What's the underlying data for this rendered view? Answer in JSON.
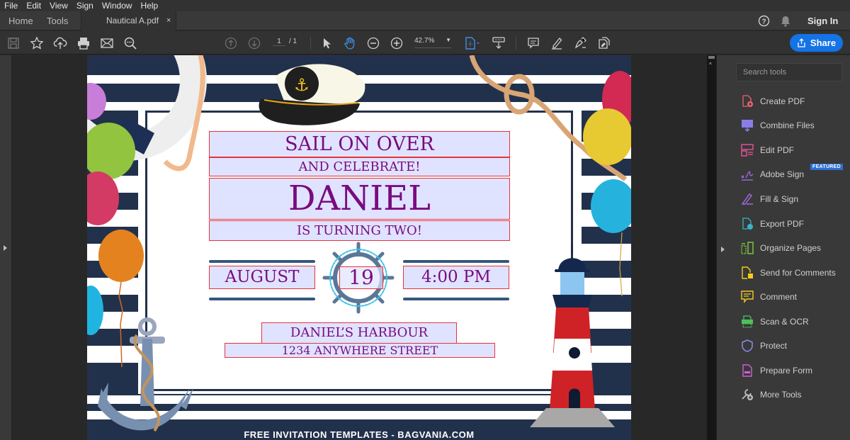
{
  "menu": [
    "File",
    "Edit",
    "View",
    "Sign",
    "Window",
    "Help"
  ],
  "nav_tabs": {
    "home": "Home",
    "tools": "Tools"
  },
  "document_tab": {
    "title": "Nautical A.pdf",
    "close": "×"
  },
  "header": {
    "sign_in": "Sign In"
  },
  "toolbar": {
    "page_current": "1",
    "page_total": "/ 1",
    "zoom_level": "42.7%",
    "share_label": "Share"
  },
  "tools_pane": {
    "search_placeholder": "Search tools",
    "featured_badge": "FEATURED",
    "items": [
      {
        "label": "Create PDF",
        "icon": "create-pdf-icon",
        "color": "#f0636b"
      },
      {
        "label": "Combine Files",
        "icon": "combine-files-icon",
        "color": "#8b7de8"
      },
      {
        "label": "Edit PDF",
        "icon": "edit-pdf-icon",
        "color": "#e8559b"
      },
      {
        "label": "Adobe Sign",
        "icon": "adobe-sign-icon",
        "color": "#a66ae8"
      },
      {
        "label": "Fill & Sign",
        "icon": "fill-sign-icon",
        "color": "#a66ae8"
      },
      {
        "label": "Export PDF",
        "icon": "export-pdf-icon",
        "color": "#38b2c9"
      },
      {
        "label": "Organize Pages",
        "icon": "organize-pages-icon",
        "color": "#7fcf3b"
      },
      {
        "label": "Send for Comments",
        "icon": "send-for-comments-icon",
        "color": "#f2cc1f"
      },
      {
        "label": "Comment",
        "icon": "comment-icon",
        "color": "#f2cc1f"
      },
      {
        "label": "Scan & OCR",
        "icon": "scan-ocr-icon",
        "color": "#4fc05a"
      },
      {
        "label": "Protect",
        "icon": "protect-icon",
        "color": "#8b8bea"
      },
      {
        "label": "Prepare Form",
        "icon": "prepare-form-icon",
        "color": "#d05fd6"
      },
      {
        "label": "More Tools",
        "icon": "more-tools-icon",
        "color": "#bcbcbc"
      }
    ]
  },
  "invitation": {
    "line1": "SAIL ON OVER",
    "line2": "AND CELEBRATE!",
    "name": "DANIEL",
    "line4": "IS TURNING TWO!",
    "month": "AUGUST",
    "day": "19",
    "time": "4:00 PM",
    "venue": "DANIEL’S HARBOUR",
    "address": "1234 ANYWHERE STREET",
    "footer": "FREE INVITATION TEMPLATES - BAGVANIA.COM"
  },
  "colors": {
    "accent": "#1473e6",
    "text_purple": "#7a0a7f",
    "navy": "#22314b",
    "field_fill": "#dfe3ff",
    "field_border": "#e8323c"
  }
}
